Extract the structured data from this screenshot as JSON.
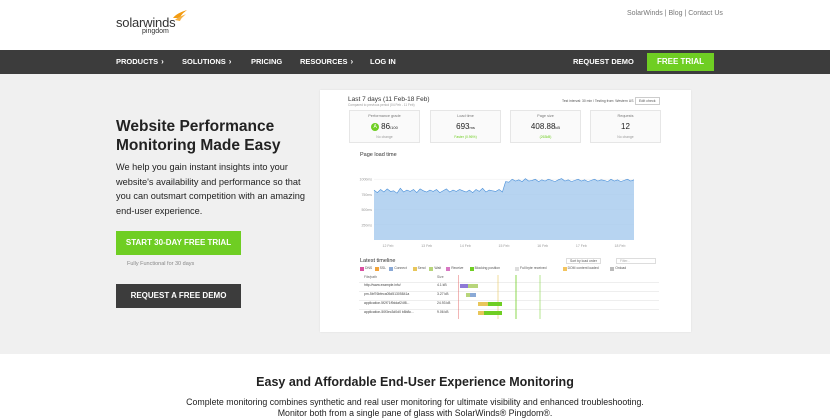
{
  "brand": {
    "name": "solarwinds",
    "sub": "pingdom"
  },
  "toplinks": [
    "SolarWinds",
    "Blog",
    "Contact Us"
  ],
  "nav": {
    "items": [
      "PRODUCTS",
      "SOLUTIONS",
      "PRICING",
      "RESOURCES",
      "LOG IN"
    ],
    "request_demo": "REQUEST DEMO",
    "free_trial": "FREE TRIAL"
  },
  "hero": {
    "title": "Website Performance Monitoring Made Easy",
    "lead": "We help you gain instant insights into your website's availability and performance so that you can outsmart competition with an amazing end-user experience.",
    "cta_primary": "START 30-DAY FREE TRIAL",
    "cta_note": "Fully Functional for 30 days",
    "cta_secondary": "REQUEST A FREE DEMO"
  },
  "dashboard": {
    "title": "Last 7 days (11 Feb-18 Feb)",
    "subtitle": "Compared to previous period (04 Feb - 11 Feb)",
    "test_interval": "Test interval: 30 min / Testing from: Western US",
    "edit_button": "Edit check",
    "cards": [
      {
        "label": "Performance grade",
        "value": "86",
        "suffix": "/100",
        "foot": "No change",
        "foot_color": "#999999"
      },
      {
        "label": "Load time",
        "value": "693",
        "suffix": "ms",
        "foot": "Faster (0.96%)",
        "foot_color": "#6fce23"
      },
      {
        "label": "Page size",
        "value": "408.88",
        "suffix": "kB",
        "foot": "(263kB)",
        "foot_color": "#6fce23"
      },
      {
        "label": "Requests",
        "value": "12",
        "suffix": "",
        "foot": "No change",
        "foot_color": "#999999"
      }
    ],
    "chart_title": "Page load time",
    "timeline_title": "Latest timeline",
    "timeline_sort": "Sort by load order",
    "timeline_filter": "Filter...",
    "legend": [
      "DNS",
      "SSL",
      "Connect",
      "Send",
      "Wait",
      "Receive",
      "Blocking position",
      "Full byte received",
      "DOM content loaded",
      "Onload"
    ],
    "legend_colors": [
      "#d94fa0",
      "#f1a33a",
      "#8aa9d6",
      "#e8c65a",
      "#b7d57a",
      "#d777c2",
      "#6fce23",
      "#dddddd",
      "#f3c45e",
      "#bbbbbb"
    ],
    "timeline_header": {
      "col1": "File/path",
      "col2": "Size"
    },
    "timeline_rows": [
      {
        "name": "http://www.example.info/",
        "size": "4.1 kB"
      },
      {
        "name": "pm-5bf76bfeca05d51305841a",
        "size": "3.27 kB"
      },
      {
        "name": "application.5f2f71f9ddaf24f8...",
        "size": "24.93 kB"
      },
      {
        "name": "application-50f3ec3d0d0 b8b8c...",
        "size": "9.06 kB"
      }
    ]
  },
  "chart_data": {
    "type": "area",
    "title": "Page load time",
    "x_ticks": [
      "12 Feb",
      "13 Feb",
      "14 Feb",
      "15 Feb",
      "16 Feb",
      "17 Feb",
      "18 Feb"
    ],
    "y_ticks": [
      "250ms",
      "500ms",
      "750ms",
      "1000ms"
    ],
    "values": [
      820,
      780,
      830,
      790,
      840,
      800,
      810,
      770,
      850,
      790,
      820,
      800,
      830,
      780,
      840,
      810,
      790,
      820,
      800,
      830,
      780,
      810,
      840,
      790,
      820,
      800,
      830,
      810,
      790,
      820,
      780,
      830,
      800,
      850,
      790,
      820,
      810,
      800,
      830,
      790,
      960,
      950,
      1000,
      970,
      990,
      960,
      1010,
      970,
      980,
      1000,
      960,
      990,
      970,
      1000,
      980,
      960,
      990,
      1010,
      970,
      990,
      960,
      980,
      1000,
      970,
      990,
      960,
      980,
      1000,
      970,
      990,
      980,
      960,
      1000,
      970,
      990,
      960,
      980,
      1000,
      970,
      990
    ],
    "ylim": [
      0,
      1250
    ],
    "color": "#9fc6ec",
    "line_color": "#4a90d9"
  },
  "bottom": {
    "title": "Easy and Affordable End-User Experience Monitoring",
    "line1": "Complete monitoring combines synthetic and real user monitoring for ultimate visibility and enhanced troubleshooting.",
    "line2": "Monitor both from a single pane of glass with SolarWinds® Pingdom®."
  }
}
